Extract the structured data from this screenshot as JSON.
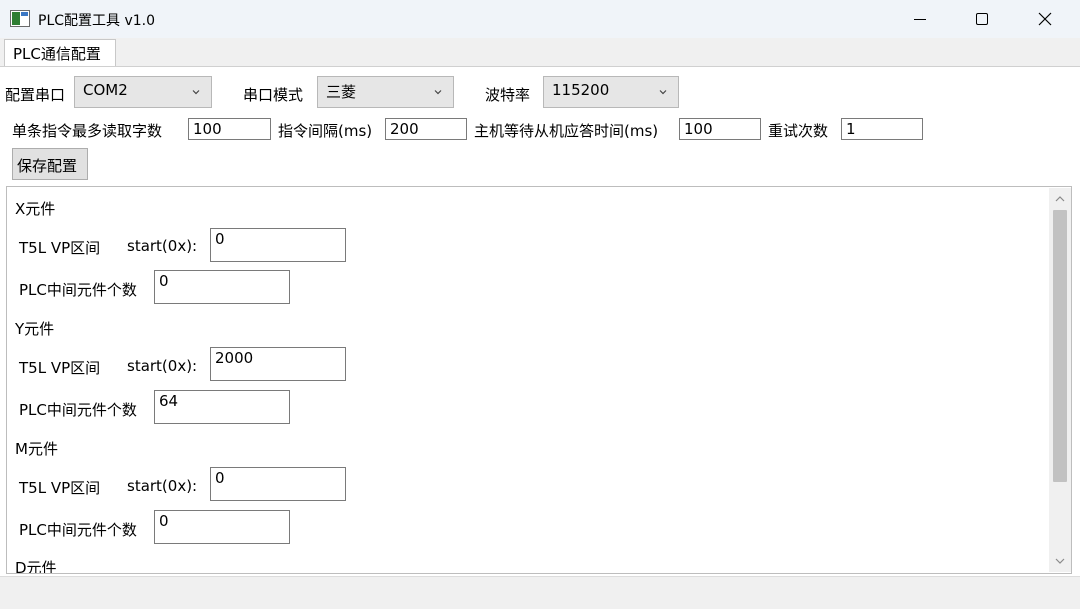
{
  "window": {
    "title": "PLC配置工具 v1.0",
    "icon": "app-window-icon",
    "controls": [
      "minimize-icon",
      "maximize-icon",
      "close-icon"
    ]
  },
  "tabs": [
    {
      "label": "PLC通信配置",
      "active": true
    }
  ],
  "serial": {
    "port_label": "配置串口",
    "port_value": "COM2",
    "mode_label": "串口模式",
    "mode_value": "三菱",
    "baud_label": "波特率",
    "baud_value": "115200"
  },
  "params": {
    "max_read_label": "单条指令最多读取字数",
    "max_read_value": "100",
    "interval_label": "指令间隔(ms)",
    "interval_value": "200",
    "wait_label": "主机等待从机应答时间(ms)",
    "wait_value": "100",
    "retry_label": "重试次数",
    "retry_value": "1"
  },
  "save_button": "保存配置",
  "sections": [
    {
      "title": "X元件",
      "vp_label": "T5L VP区间",
      "start_label": "start(0x):",
      "start_value": "0",
      "count_label": "PLC中间元件个数",
      "count_value": "0"
    },
    {
      "title": "Y元件",
      "vp_label": "T5L VP区间",
      "start_label": "start(0x):",
      "start_value": "2000",
      "count_label": "PLC中间元件个数",
      "count_value": "64"
    },
    {
      "title": "M元件",
      "vp_label": "T5L VP区间",
      "start_label": "start(0x):",
      "start_value": "0",
      "count_label": "PLC中间元件个数",
      "count_value": "0"
    },
    {
      "title": "D元件"
    }
  ],
  "colors": {
    "titlebar": "#f0f4f9",
    "panel": "#ffffff",
    "combo": "#e6e6e6",
    "scroll_thumb": "#c2c2c2"
  }
}
